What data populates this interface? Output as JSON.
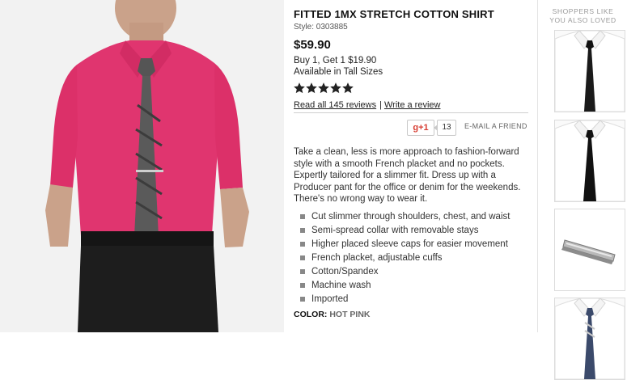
{
  "product": {
    "title": "FITTED 1MX STRETCH COTTON SHIRT",
    "style": "Style: 0303885",
    "price": "$59.90",
    "promo_line1": "Buy 1, Get 1 $19.90",
    "promo_line2": "Available in Tall Sizes",
    "rating": 5,
    "rating_max": 5,
    "read_reviews": "Read all 145 reviews",
    "review_separator": "|",
    "write_review": "Write a review",
    "gplus_label": "g+1",
    "gplus_count": "13",
    "email_friend": "E-MAIL A FRIEND",
    "description": "Take a clean, less is more approach to fashion-forward style with a smooth French placket and no pockets. Expertly tailored for a slimmer fit. Dress up with a Producer pant for the office or denim for the weekends. There's no wrong way to wear it.",
    "features": [
      "Cut slimmer through shoulders, chest, and waist",
      "Semi-spread collar with removable stays",
      "Higher placed sleeve caps for easier movement",
      "French placket, adjustable cuffs",
      "Cotton/Spandex",
      "Machine wash",
      "Imported"
    ],
    "color_label": "COLOR:",
    "color_value": "HOT PINK"
  },
  "rail": {
    "title_line1": "SHOPPERS LIKE",
    "title_line2": "YOU ALSO LOVED",
    "items": [
      "white shirt with black tie",
      "white shirt with black tie",
      "silver tie bar",
      "white shirt with striped tie"
    ]
  },
  "colors": {
    "shirt": "#e0356f",
    "pants": "#1d1d1d",
    "tie": "#5a5a5a",
    "star": "#222222"
  }
}
